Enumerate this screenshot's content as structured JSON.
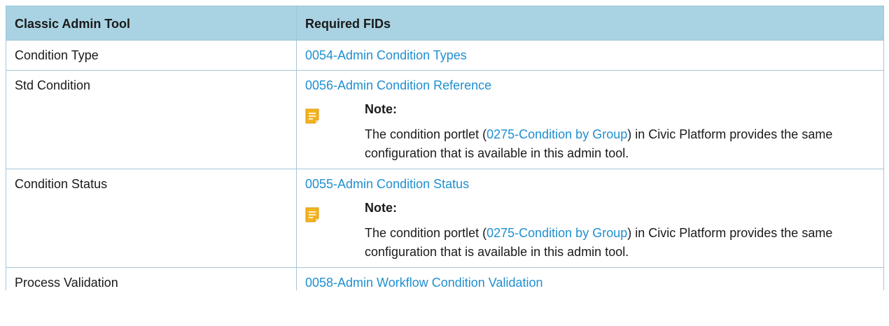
{
  "table": {
    "headers": [
      "Classic Admin Tool",
      "Required FIDs"
    ],
    "rows": [
      {
        "tool": "Condition Type",
        "fid": "0054-Admin Condition Types"
      },
      {
        "tool": "Std Condition",
        "fid": "0056-Admin Condition Reference",
        "note": {
          "title": "Note:",
          "text_before": "The condition portlet (",
          "link": "0275-Condition by Group",
          "text_after": ") in Civic Platform provides the same configuration that is available in this admin tool."
        }
      },
      {
        "tool": "Condition Status",
        "fid": "0055-Admin Condition Status",
        "note": {
          "title": "Note:",
          "text_before": "The condition portlet (",
          "link": "0275-Condition by Group",
          "text_after": ") in Civic Platform provides the same configuration that is available in this admin tool."
        }
      },
      {
        "tool": "Process Validation",
        "fid": "0058-Admin Workflow Condition Validation"
      }
    ]
  },
  "icons": {
    "note": "note-icon"
  },
  "colors": {
    "header_bg": "#a9d3e3",
    "link": "#1f8fd0",
    "border": "#a6c6d8",
    "note_icon": "#f2b31f"
  }
}
